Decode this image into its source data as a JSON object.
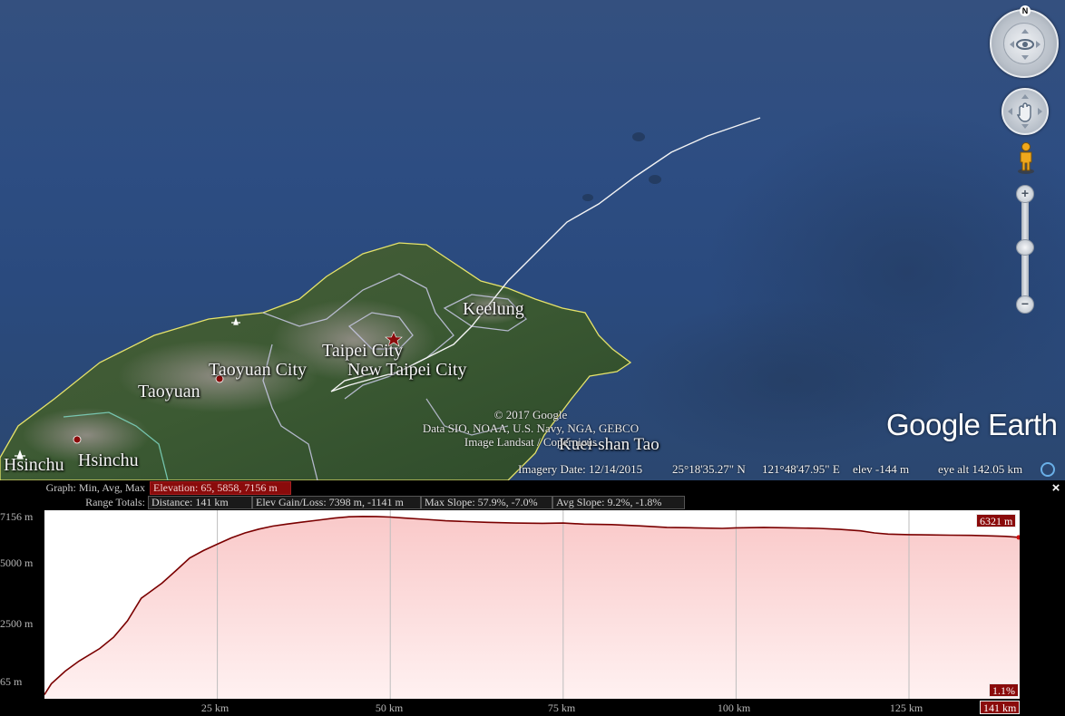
{
  "map": {
    "labels": {
      "keelung": "Keelung",
      "taipei_city": "Taipei City",
      "new_taipei_city": "New Taipei City",
      "taoyuan_city": "Taoyuan City",
      "taoyuan": "Taoyuan",
      "hsinchu_left": "Hsinchu",
      "hsinchu": "Hsinchu",
      "kueishan": "Kuei-shan Tao"
    },
    "attribution": {
      "line1": "© 2017 Google",
      "line2": "Data SIO, NOAA, U.S. Navy, NGA, GEBCO",
      "line3": "Image Landsat / Copernicus"
    },
    "logo": "Google Earth",
    "compass_letter": "N",
    "controls": {
      "look_icon": "eye-icon",
      "pan_icon": "hand-icon",
      "streetview_icon": "pegman-icon",
      "zoom_in": "+",
      "zoom_out": "−"
    }
  },
  "status": {
    "imagery_date": "Imagery Date: 12/14/2015",
    "lat": "25°18'35.27\" N",
    "lon": "121°48'47.95\" E",
    "elev": "elev  -144 m",
    "eye_alt": "eye alt 142.05 km"
  },
  "profile": {
    "graph_label": "Graph: Min, Avg, Max",
    "elevation_summary": "Elevation: 65, 5858, 7156 m",
    "range_label": "Range Totals:",
    "distance": "Distance: 141 km",
    "gain_loss": "Elev Gain/Loss: 7398 m, -1141 m",
    "max_slope": "Max Slope: 57.9%, -7.0%",
    "avg_slope": "Avg Slope: 9.2%, -1.8%",
    "close": "×",
    "current_elev_tag": "6321 m",
    "current_slope_tag": "1.1%",
    "current_dist_tag": "141 km",
    "colors": {
      "fill_top": "#f9c9c9",
      "fill_bottom": "#fff1f1",
      "line": "#7a0000",
      "tag_bg": "#8a0b0b"
    }
  },
  "chart_data": {
    "type": "area",
    "title": "",
    "xlabel": "",
    "ylabel": "",
    "xlim": [
      0,
      141
    ],
    "ylim": [
      -100,
      7400
    ],
    "x_ticks": [
      "25 km",
      "50 km",
      "75 km",
      "100 km",
      "125 km"
    ],
    "x_tick_values": [
      25,
      50,
      75,
      100,
      125
    ],
    "y_ticks": [
      "7156 m",
      "5000 m",
      "2500 m",
      "65 m"
    ],
    "y_tick_values": [
      7156,
      5000,
      2500,
      65
    ],
    "grid": true,
    "series": [
      {
        "x": [
          0,
          1,
          3,
          5,
          8,
          10,
          12,
          14,
          15,
          17,
          19,
          21,
          23,
          25,
          27,
          29,
          31,
          33,
          35,
          37,
          40,
          42,
          44,
          46,
          48,
          50,
          52,
          55,
          58,
          60,
          64,
          68,
          72,
          75,
          78,
          82,
          86,
          90,
          94,
          98,
          100,
          104,
          108,
          112,
          115,
          118,
          120,
          122,
          125,
          128,
          131,
          134,
          137,
          139,
          141
        ],
        "y": [
          65,
          500,
          1000,
          1400,
          1900,
          2350,
          3000,
          3900,
          4100,
          4500,
          5000,
          5500,
          5800,
          6050,
          6300,
          6500,
          6650,
          6770,
          6850,
          6920,
          7020,
          7090,
          7140,
          7156,
          7150,
          7130,
          7090,
          7040,
          6980,
          6960,
          6920,
          6890,
          6880,
          6890,
          6850,
          6830,
          6780,
          6720,
          6700,
          6680,
          6700,
          6720,
          6700,
          6680,
          6640,
          6580,
          6500,
          6450,
          6430,
          6420,
          6410,
          6400,
          6380,
          6360,
          6321
        ]
      }
    ]
  }
}
